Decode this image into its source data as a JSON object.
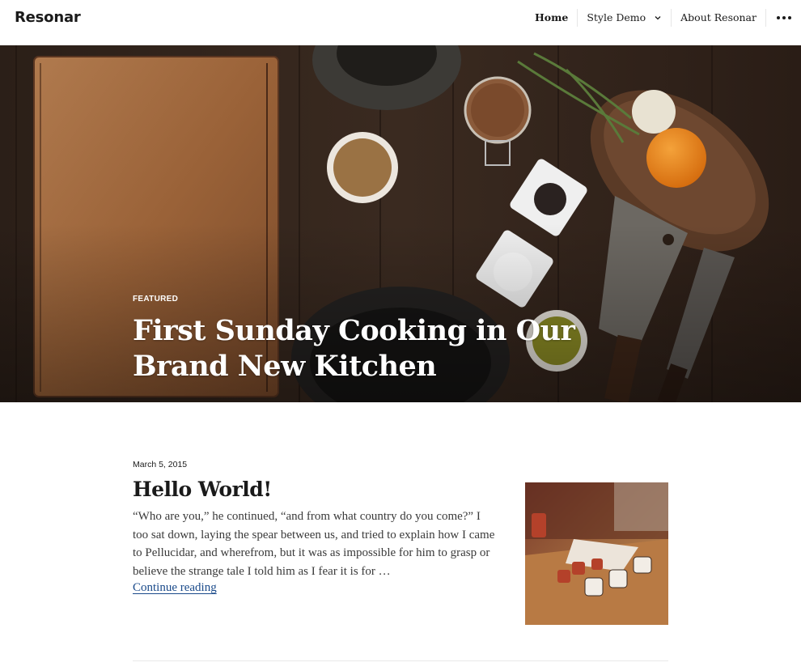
{
  "site": {
    "title": "Resonar"
  },
  "nav": {
    "items": [
      {
        "label": "Home",
        "active": true
      },
      {
        "label": "Style Demo",
        "has_submenu": true
      },
      {
        "label": "About Resonar"
      }
    ],
    "more_icon": "more-dots-icon"
  },
  "hero": {
    "badge": "FEATURED",
    "title": "First Sunday Cooking in Our Brand New Kitchen"
  },
  "post": {
    "date": "March 5, 2015",
    "title": "Hello World!",
    "excerpt": "“Who are you,” he continued, “and from what country do you come?” I too sat down, laying the spear between us, and tried to explain how I came to Pellucidar, and wherefrom, but it was as impossible for him to grasp or believe the strange tale I told him as I fear it is for …",
    "continue_label": "Continue reading"
  },
  "colors": {
    "link": "#1a4a8a",
    "text": "#1a1a1a",
    "hero_bg": "#2a1e16"
  }
}
